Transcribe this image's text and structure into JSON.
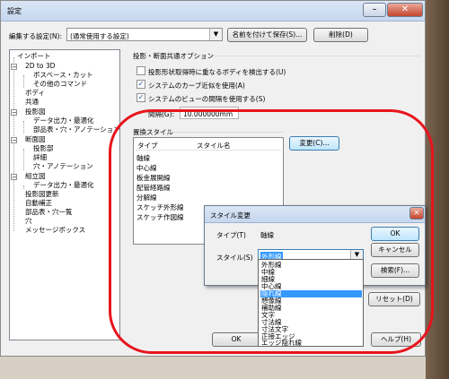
{
  "window": {
    "title": "設定",
    "minimize": "–",
    "close": "✕"
  },
  "top": {
    "edit_label": "編集する設定(N):",
    "edit_value": "(通常使用する設定)",
    "save_as": "名前を付けて保存(S)...",
    "delete": "削除(D)"
  },
  "tree": [
    {
      "label": "インポート",
      "box": ""
    },
    {
      "label": "2D to 3D",
      "box": "−"
    },
    {
      "label": "ボスベース・カット",
      "box": ""
    },
    {
      "label": "その他のコマンド",
      "box": ""
    },
    {
      "label": "ボディ",
      "box": ""
    },
    {
      "label": "共通",
      "box": ""
    },
    {
      "label": "投影図",
      "box": "−"
    },
    {
      "label": "データ出力・最適化",
      "box": ""
    },
    {
      "label": "部品表・穴・アノテーション",
      "box": ""
    },
    {
      "label": "断面図",
      "box": "−"
    },
    {
      "label": "投影部",
      "box": ""
    },
    {
      "label": "詳細",
      "box": ""
    },
    {
      "label": "穴・アノテーション",
      "box": ""
    },
    {
      "label": "組立図",
      "box": "−"
    },
    {
      "label": "データ出力・最適化",
      "box": ""
    },
    {
      "label": "投影図更新",
      "box": ""
    },
    {
      "label": "自動補正",
      "box": ""
    },
    {
      "label": "部品表・穴一覧",
      "box": ""
    },
    {
      "label": "穴",
      "box": ""
    },
    {
      "label": "メッセージボックス",
      "box": ""
    }
  ],
  "options": {
    "group_title": "投影・断面共通オプション",
    "chk1": "投影形状取得時に重なるボディを検出する(U)",
    "chk2": "システムのカーブ近似を使用(A)",
    "chk3": "システムのビューの間隔を使用する(S)",
    "gap_label": "間隔(G):",
    "gap_value": "10.000000mm"
  },
  "replace": {
    "title": "置換スタイル",
    "col_type": "タイプ",
    "col_style": "スタイル名",
    "rows": [
      "軸線",
      "中心線",
      "板金展開線",
      "配管経路線",
      "分解線",
      "スケッチ外形線",
      "スケッチ作図線"
    ],
    "change_btn": "変更(C)...",
    "reset_btn": "リセット(D)"
  },
  "footer": {
    "ok": "OK",
    "help": "ヘルプ(H)"
  },
  "style_dialog": {
    "title": "スタイル変更",
    "type_label": "タイプ(T)",
    "type_value": "軸線",
    "style_label": "スタイル(S)",
    "style_value": "外形線",
    "ok": "OK",
    "cancel": "キャンセル",
    "browse": "検索(F)...",
    "close": "✕"
  },
  "dropdown_items": [
    "外形線",
    "中線",
    "細線",
    "中心線",
    "隠れ線",
    "想像線",
    "補助線",
    "文字",
    "寸法線",
    "寸法文字",
    "正接エッジ",
    "エッジ隠れ線"
  ],
  "dropdown_selected_index": 4,
  "colors": {
    "highlight": "#e8141c",
    "selection": "#3399ff"
  }
}
